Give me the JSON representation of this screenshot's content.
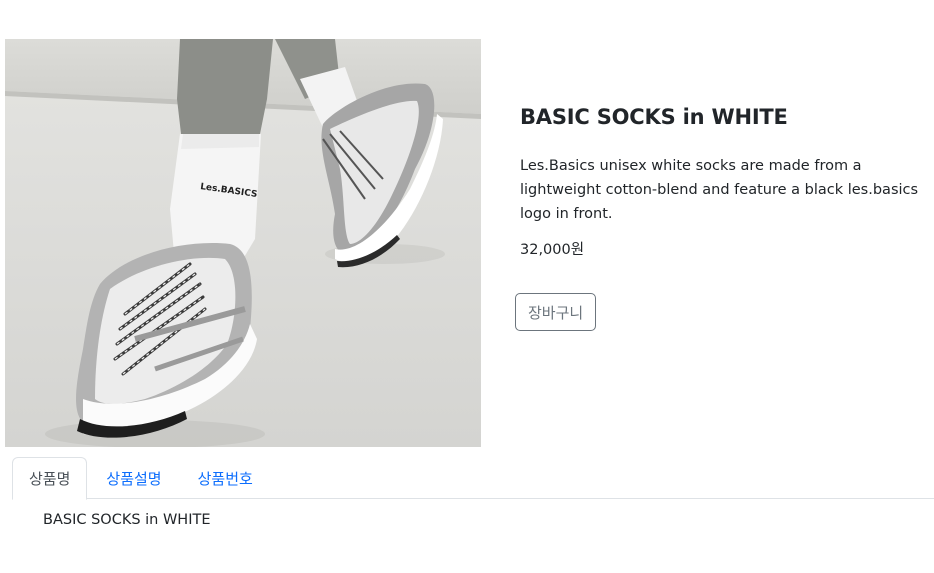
{
  "product": {
    "image_alt": "white sneakers with white socks",
    "sock_logo_text": "Les.BASICS",
    "title": "BASIC SOCKS in WHITE",
    "description": "Les.Basics unisex white socks are made from a lightweight cotton-blend and feature a black les.basics logo in front.",
    "price": "32,000원",
    "cart_label": "장바구니"
  },
  "tabs": [
    {
      "label": "상품명",
      "active": true
    },
    {
      "label": "상품설명",
      "active": false
    },
    {
      "label": "상품번호",
      "active": false
    }
  ],
  "tab_content": "BASIC SOCKS in WHITE",
  "colors": {
    "link": "#0d6efd",
    "text": "#212529",
    "muted": "#6c757d",
    "border": "#dee2e6"
  }
}
